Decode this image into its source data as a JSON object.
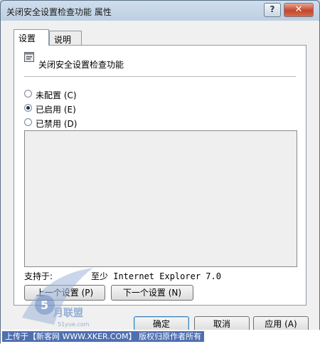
{
  "window": {
    "title": "关闭安全设置检查功能 属性",
    "help_label": "?",
    "close_label": "✕"
  },
  "tabs": [
    {
      "label": "设置",
      "active": true
    },
    {
      "label": "说明",
      "active": false
    }
  ],
  "policy": {
    "icon": "policy-setting-icon",
    "name": "关闭安全设置检查功能"
  },
  "options": [
    {
      "label": "未配置 (C)",
      "checked": false
    },
    {
      "label": "已启用 (E)",
      "checked": true
    },
    {
      "label": "已禁用 (D)",
      "checked": false
    }
  ],
  "support": {
    "label": "支持于:",
    "value": "至少 Internet Explorer 7.0"
  },
  "nav": {
    "prev_label": "上一个设置 (P)",
    "next_label": "下一个设置 (N)"
  },
  "footer": {
    "ok_label": "确定",
    "cancel_label": "取消",
    "apply_label": "应用 (A)"
  },
  "watermark": {
    "text": "上传于【新客网 WWW.XKER.COM】 版权归原作者所有",
    "logo_text": "51yue.com",
    "logo_alt": "月联盟"
  }
}
